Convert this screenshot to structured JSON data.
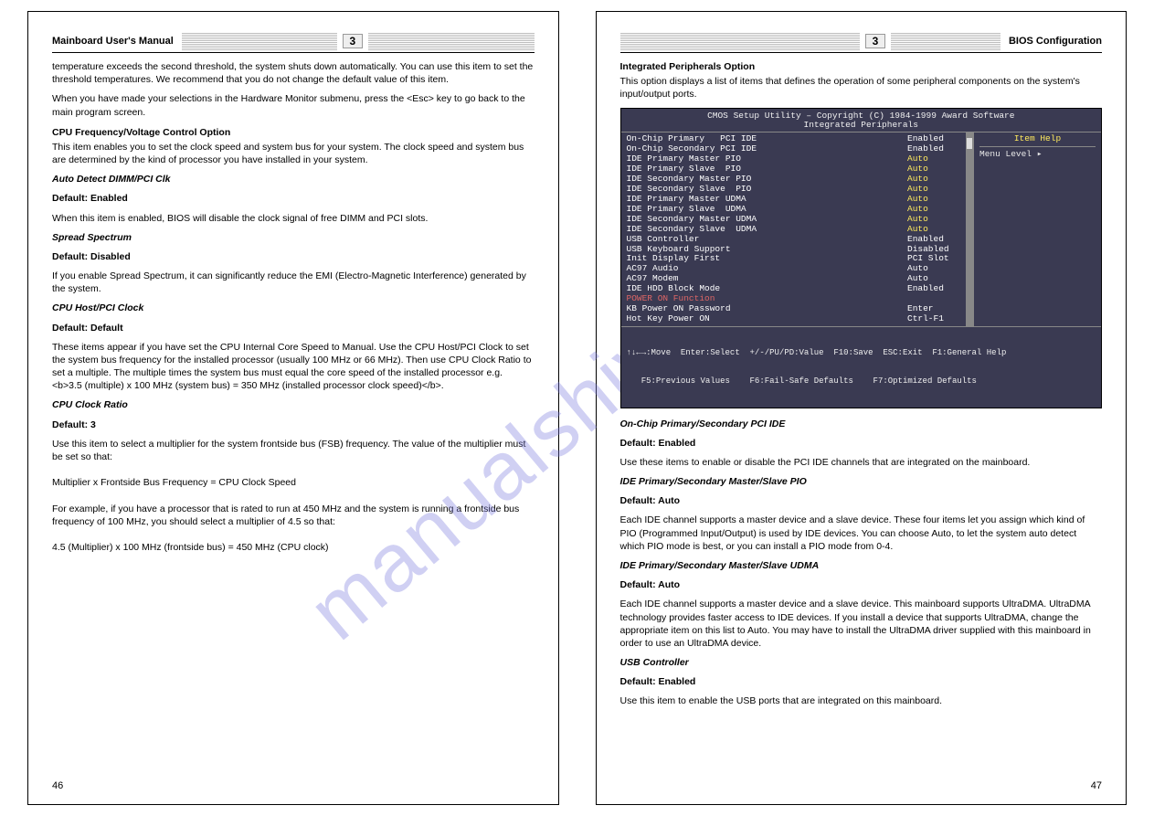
{
  "watermark": "manualshive.com",
  "left_page": {
    "section_label_left": "Mainboard User's Manual",
    "section_num": "3",
    "section_label_right": "",
    "page_number": "46",
    "paragraphs": [
      "temperature exceeds the second threshold, the system shuts down automatically. You can use this item to set the threshold temperatures. We recommend that you do not change the default value of this item.",
      "",
      "When you have made your selections in the Hardware Monitor submenu, press the <Esc> key to go back to the main program screen.",
      "",
      "<b>CPU Frequency/Voltage Control Option</b>",
      "This item enables you to set the clock speed and system bus for your system. The clock speed and system bus are determined by the kind of processor you have installed in your system."
    ],
    "settings": [
      {
        "name": "Auto Detect DIMM/PCI Clk",
        "default": "Default: Enabled",
        "desc": "When this item is enabled, BIOS will disable the clock signal of free DIMM and PCI slots."
      },
      {
        "name": "Spread Spectrum",
        "default": "Default: Disabled",
        "desc": "If you enable Spread Spectrum, it can significantly reduce the EMI (Electro-Magnetic Interference) generated by the system."
      },
      {
        "name": "CPU Host/PCI Clock",
        "default": "Default: Default",
        "desc": "These items appear if you have set the CPU Internal Core Speed to Manual. Use the CPU Host/PCI Clock to set the system bus frequency for the installed processor (usually 100 MHz or 66 MHz). Then use CPU Clock Ratio to set a multiple. The multiple times the system bus must equal the core speed of the installed processor e.g. <b>3.5 (multiple) x 100 MHz (system bus) = 350 MHz (installed processor clock speed)</b>."
      },
      {
        "name": "CPU Clock Ratio",
        "default": "Default: 3",
        "desc": "Use this item to select a multiplier for the system frontside bus (FSB) frequency. The value of the multiplier must be set so that:\n\nMultiplier x Frontside Bus Frequency = CPU Clock Speed\n\nFor example, if you have a processor that is rated to run at 450 MHz and the system is running a frontside bus frequency of 100 MHz, you should select a multiplier of 4.5 so that:\n\n4.5 (Multiplier) x 100 MHz (frontside bus) = 450 MHz (CPU clock)"
      }
    ]
  },
  "right_page": {
    "section_label_left": "",
    "section_num": "3",
    "section_label_right": "BIOS Configuration",
    "page_number": "47",
    "intro_title": "Integrated Peripherals Option",
    "intro_text": "This option displays a list of items that defines the operation of some peripheral components on the system's input/output ports.",
    "bios": {
      "title1": "CMOS Setup Utility – Copyright (C) 1984-1999 Award Software",
      "title2": "Integrated Peripherals",
      "help_header": "Item Help",
      "help_line": "Menu Level    ▸",
      "rows": [
        {
          "k": "On-Chip Primary   PCI IDE",
          "v": "Enabled",
          "hl": false
        },
        {
          "k": "On-Chip Secondary PCI IDE",
          "v": "Enabled",
          "hl": false
        },
        {
          "k": "IDE Primary Master PIO",
          "v": "Auto",
          "hl": true
        },
        {
          "k": "IDE Primary Slave  PIO",
          "v": "Auto",
          "hl": true
        },
        {
          "k": "IDE Secondary Master PIO",
          "v": "Auto",
          "hl": true
        },
        {
          "k": "IDE Secondary Slave  PIO",
          "v": "Auto",
          "hl": true
        },
        {
          "k": "IDE Primary Master UDMA",
          "v": "Auto",
          "hl": true
        },
        {
          "k": "IDE Primary Slave  UDMA",
          "v": "Auto",
          "hl": true
        },
        {
          "k": "IDE Secondary Master UDMA",
          "v": "Auto",
          "hl": true
        },
        {
          "k": "IDE Secondary Slave  UDMA",
          "v": "Auto",
          "hl": true
        },
        {
          "k": "USB Controller",
          "v": "Enabled",
          "hl": false
        },
        {
          "k": "USB Keyboard Support",
          "v": "Disabled",
          "hl": false
        },
        {
          "k": "Init Display First",
          "v": "PCI Slot",
          "hl": false
        },
        {
          "k": "AC97 Audio",
          "v": "Auto",
          "hl": false
        },
        {
          "k": "AC97 Modem",
          "v": "Auto",
          "hl": false
        },
        {
          "k": "IDE HDD Block Mode",
          "v": "Enabled",
          "hl": false
        },
        {
          "k": "POWER ON Function",
          "v": "",
          "hl": false,
          "red": true
        },
        {
          "k": "KB Power ON Password",
          "v": "Enter",
          "hl": false
        },
        {
          "k": "Hot Key Power ON",
          "v": "Ctrl-F1",
          "hl": false
        }
      ],
      "foot1": "↑↓←→:Move  Enter:Select  +/-/PU/PD:Value  F10:Save  ESC:Exit  F1:General Help",
      "foot2": "   F5:Previous Values    F6:Fail-Safe Defaults    F7:Optimized Defaults"
    },
    "settings": [
      {
        "name": "On-Chip Primary/Secondary PCI IDE",
        "default": "Default: Enabled",
        "desc": "Use these items to enable or disable the PCI IDE channels that are integrated on the mainboard."
      },
      {
        "name": "IDE Primary/Secondary Master/Slave PIO",
        "default": "Default: Auto",
        "desc": "Each IDE channel supports a master device and a slave device. These four items let you assign which kind of PIO (Programmed Input/Output) is used by IDE devices. You can choose Auto, to let the system auto detect which PIO mode is best, or you can install a PIO mode from 0-4."
      },
      {
        "name": "IDE Primary/Secondary Master/Slave UDMA",
        "default": "Default: Auto",
        "desc": "Each IDE channel supports a master device and a slave device. This mainboard supports UltraDMA. UltraDMA technology provides faster access to IDE devices. If you install a device that supports UltraDMA, change the appropriate item on this list to Auto. You may have to install the UltraDMA driver supplied with this mainboard in order to use an UltraDMA device."
      },
      {
        "name": "USB Controller",
        "default": "Default: Enabled",
        "desc": "Use this item to enable the USB ports that are integrated on this mainboard."
      }
    ]
  }
}
